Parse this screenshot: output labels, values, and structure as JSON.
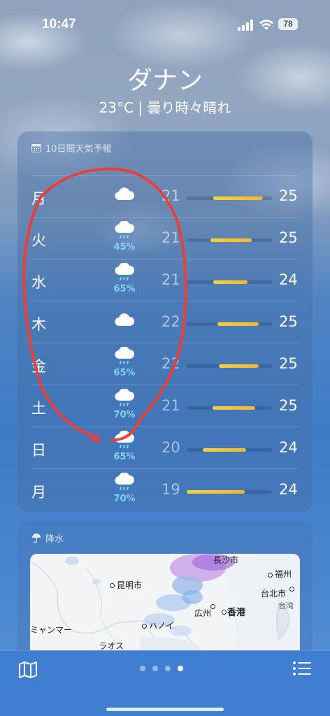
{
  "status": {
    "time": "10:47",
    "battery": "78"
  },
  "location": {
    "city": "ダナン",
    "summary": "23°C | 曇り時々晴れ"
  },
  "forecast": {
    "title": "10日間天気予報",
    "days": [
      {
        "day": "月",
        "icon": "cloud-icon",
        "pop": "",
        "low": "21",
        "high": "25",
        "bar_start": 0.31,
        "bar_end": 0.89
      },
      {
        "day": "火",
        "icon": "cloud-rain-icon",
        "pop": "45%",
        "low": "21",
        "high": "25",
        "bar_start": 0.28,
        "bar_end": 0.76
      },
      {
        "day": "水",
        "icon": "cloud-rain-icon",
        "pop": "65%",
        "low": "21",
        "high": "24",
        "bar_start": 0.31,
        "bar_end": 0.71
      },
      {
        "day": "木",
        "icon": "cloud-icon",
        "pop": "",
        "low": "22",
        "high": "25",
        "bar_start": 0.36,
        "bar_end": 0.84
      },
      {
        "day": "金",
        "icon": "cloud-rain-icon",
        "pop": "65%",
        "low": "22",
        "high": "25",
        "bar_start": 0.38,
        "bar_end": 0.85
      },
      {
        "day": "土",
        "icon": "cloud-rain-icon",
        "pop": "70%",
        "low": "21",
        "high": "25",
        "bar_start": 0.3,
        "bar_end": 0.8
      },
      {
        "day": "日",
        "icon": "cloud-rain-icon",
        "pop": "65%",
        "low": "20",
        "high": "24",
        "bar_start": 0.19,
        "bar_end": 0.7
      },
      {
        "day": "月",
        "icon": "cloud-rain-icon",
        "pop": "70%",
        "low": "19",
        "high": "24",
        "bar_start": 0.0,
        "bar_end": 0.68
      }
    ]
  },
  "precipitation": {
    "title": "降水",
    "labels": {
      "changsha": "長沙市",
      "kunming": "昆明市",
      "fuzhou": "福州",
      "taipei": "台北市",
      "taiwan": "台湾",
      "guangzhou": "広州",
      "hongkong": "香港",
      "hanoi": "ハノイ",
      "myanmar": "ミャンマー",
      "laos": "ラオス"
    }
  },
  "toolbar": {
    "pages": 4,
    "active_page": 4
  },
  "colors": {
    "temp_bar": "#f6c12e",
    "precip_text": "#7fd2ff",
    "annotation": "#e8403a"
  }
}
